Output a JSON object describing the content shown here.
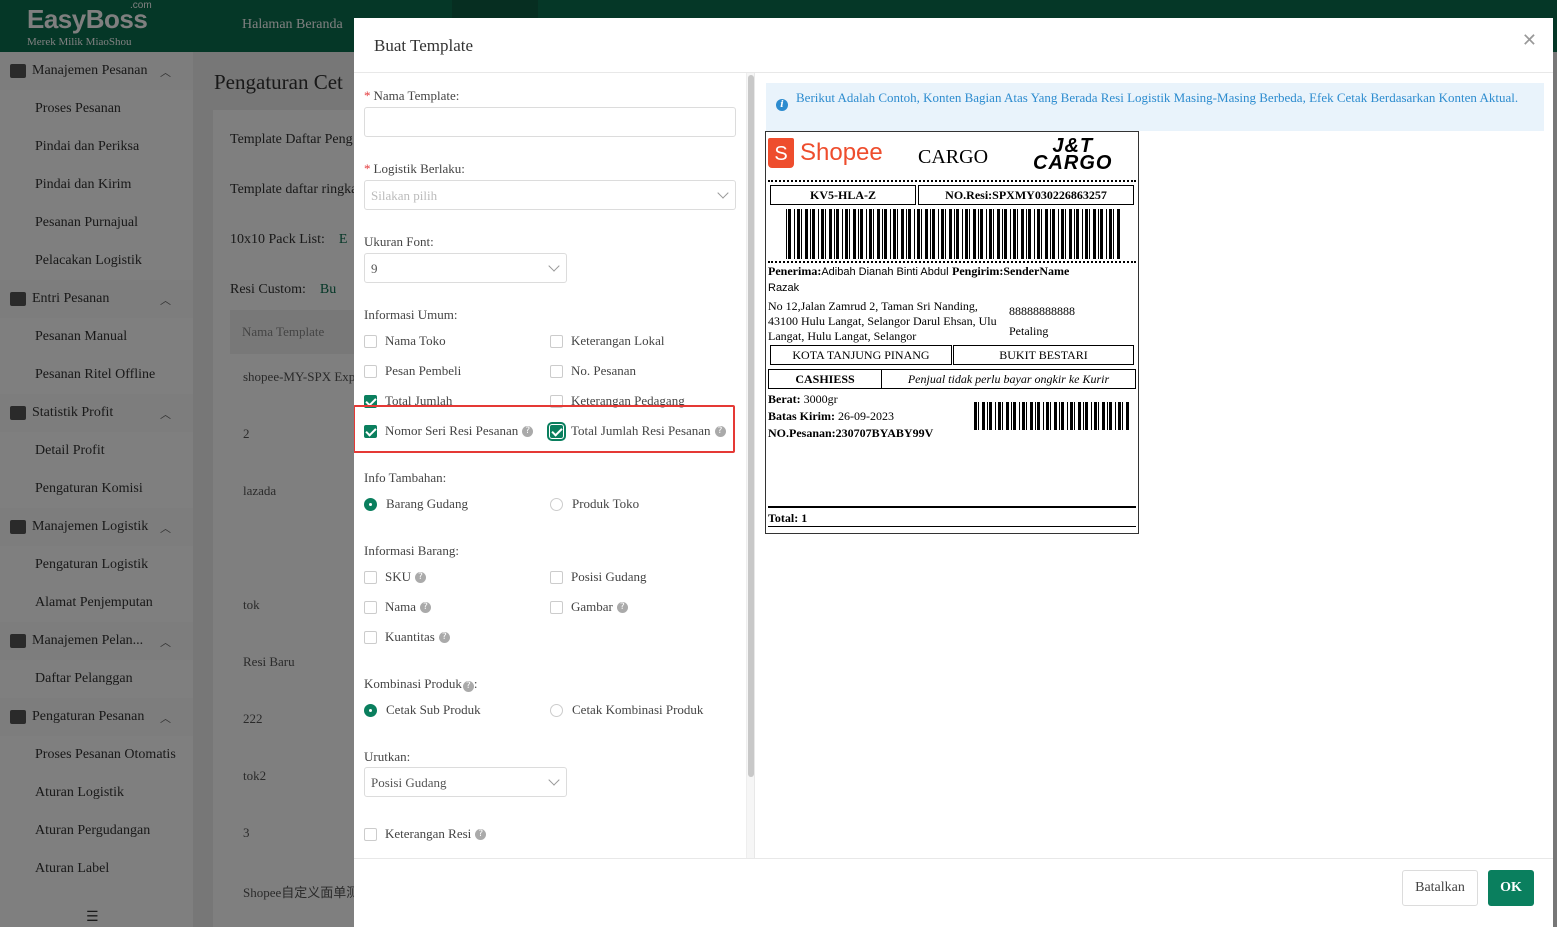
{
  "app": {
    "logo": "EasyBoss",
    "logo_suffix": ".com",
    "logo_sub": "Merek Milik MiaoShou",
    "top_nav": "Halaman Beranda"
  },
  "sidebar": {
    "groups": [
      {
        "label": "Manajemen Pesanan",
        "items": [
          "Proses Pesanan",
          "Pindai dan Periksa",
          "Pindai dan Kirim",
          "Pesanan Purnajual",
          "Pelacakan Logistik"
        ]
      },
      {
        "label": "Entri Pesanan",
        "items": [
          "Pesanan Manual",
          "Pesanan Ritel Offline"
        ]
      },
      {
        "label": "Statistik Profit",
        "items": [
          "Detail Profit",
          "Pengaturan Komisi"
        ]
      },
      {
        "label": "Manajemen Logistik",
        "items": [
          "Pengaturan Logistik",
          "Alamat Penjemputan"
        ]
      },
      {
        "label": "Manajemen Pelan...",
        "items": [
          "Daftar Pelanggan"
        ]
      },
      {
        "label": "Pengaturan Pesanan",
        "items": [
          "Proses Pesanan Otomatis",
          "Aturan Logistik",
          "Aturan Pergudangan",
          "Aturan Label"
        ]
      }
    ]
  },
  "page": {
    "title": "Pengaturan Cet",
    "rows": [
      "Template Daftar Peng",
      "Template daftar ringka",
      "10x10 Pack List:",
      "Resi Custom:"
    ],
    "row_links": [
      "",
      "",
      "E",
      "Bu"
    ],
    "table_header": "Nama Template",
    "table_cells": [
      "shopee-MY-SPX Exp",
      "2",
      "lazada",
      "tok",
      "Resi Baru",
      "222",
      "tok2",
      "3",
      "Shopee自定义面单测"
    ]
  },
  "modal": {
    "title": "Buat Template",
    "form": {
      "template_name_label": "Nama Template:",
      "template_name_value": "",
      "logistics_label": "Logistik Berlaku:",
      "logistics_placeholder": "Silakan pilih",
      "font_size_label": "Ukuran Font:",
      "font_size_value": "9",
      "general_info_label": "Informasi Umum:",
      "general_info": [
        {
          "label": "Nama Toko",
          "checked": false,
          "help": false
        },
        {
          "label": "Keterangan Lokal",
          "checked": false,
          "help": false
        },
        {
          "label": "Pesan Pembeli",
          "checked": false,
          "help": false
        },
        {
          "label": "No. Pesanan",
          "checked": false,
          "help": false
        },
        {
          "label": "Total Jumlah",
          "checked": true,
          "help": false
        },
        {
          "label": "Keterangan Pedagang",
          "checked": false,
          "help": false
        },
        {
          "label": "Nomor Seri Resi Pesanan",
          "checked": true,
          "help": true
        },
        {
          "label": "Total Jumlah Resi Pesanan",
          "checked": true,
          "help": true
        }
      ],
      "extra_info_label": "Info Tambahan:",
      "extra_info_options": [
        "Barang Gudang",
        "Produk Toko"
      ],
      "extra_info_selected": "Barang Gudang",
      "item_info_label": "Informasi Barang:",
      "item_info": [
        {
          "label": "SKU",
          "checked": false
        },
        {
          "label": "Posisi Gudang",
          "checked": false
        },
        {
          "label": "Nama",
          "checked": false
        },
        {
          "label": "Gambar",
          "checked": false
        },
        {
          "label": "Kuantitas",
          "checked": false
        }
      ],
      "combo_label": "Kombinasi Produk",
      "combo_options": [
        "Cetak Sub Produk",
        "Cetak Kombinasi Produk"
      ],
      "combo_selected": "Cetak Sub Produk",
      "sort_label": "Urutkan:",
      "sort_value": "Posisi Gudang",
      "resi_note_label": "Keterangan Resi"
    },
    "notice": "Berikut Adalah Contoh, Konten Bagian Atas Yang Berada Resi Logistik Masing-Masing Berbeda, Efek Cetak Berdasarkan Konten Aktual.",
    "preview": {
      "shopee_text": "Shopee",
      "shopee_glyph": "S",
      "cargo": "CARGO",
      "jt_line1": "J&T",
      "jt_line2": "CARGO",
      "code": "KV5-HLA-Z",
      "resi": "NO.Resi:SPXMY030226863257",
      "recipient_label": "Penerima:",
      "recipient_name": "Adibah Dianah Binti Abdul Razak",
      "sender_label": "Pengirim:",
      "sender_name": "SenderName",
      "address": "No 12,Jalan Zamrud 2, Taman Sri Nanding, 43100 Hulu Langat, Selangor Darul Ehsan, Ulu Langat, Hulu Langat, Selangor",
      "phone": "88888888888",
      "district": "Petaling",
      "city1": "KOTA TANJUNG PINANG",
      "city2": "BUKIT BESTARI",
      "payment": "CASHIESS",
      "payment_note": "Penjual tidak perlu bayar ongkir ke Kurir",
      "weight_label": "Berat:",
      "weight": "3000gr",
      "deadline_label": "Batas Kirim:",
      "deadline": "26-09-2023",
      "order_label": "NO.Pesanan:",
      "order": "230707BYABY99V",
      "total": "Total: 1"
    },
    "footer": {
      "cancel": "Batalkan",
      "ok": "OK"
    }
  },
  "colors": {
    "brand": "#0a6e4f",
    "accent": "#0a7f5e",
    "highlight": "#e53935",
    "shopee": "#ee4d2d",
    "info": "#2d8ccf"
  }
}
